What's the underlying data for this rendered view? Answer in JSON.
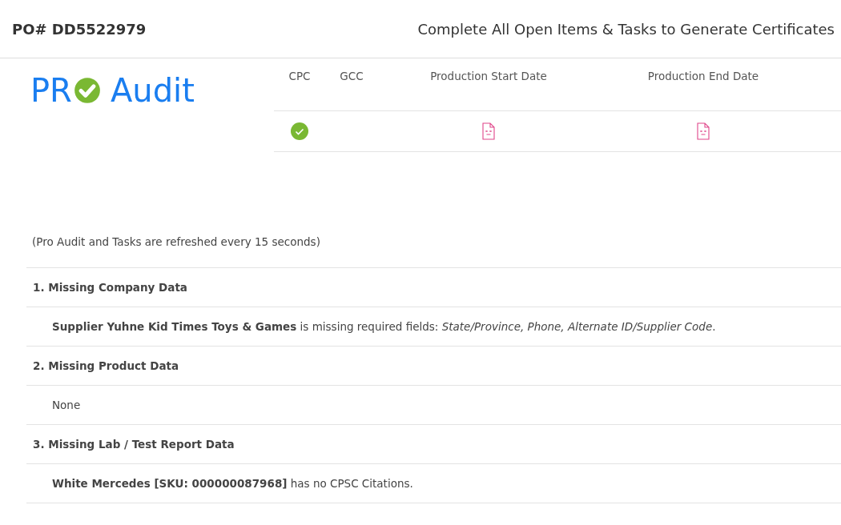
{
  "header": {
    "po_number": "PO# DD5522979",
    "message": "Complete All Open Items & Tasks to Generate Certificates"
  },
  "logo": {
    "prefix": "PR",
    "suffix": "Audit"
  },
  "status_table": {
    "columns": [
      {
        "label": "CPC",
        "kind": "complete"
      },
      {
        "label": "GCC"
      },
      {
        "label": "Production Start Date",
        "kind": "missing"
      },
      {
        "label": "Production End Date",
        "kind": "missing"
      }
    ]
  },
  "refresh_note": "(Pro Audit and Tasks are refreshed every 15 seconds)",
  "sections": [
    {
      "title": "1. Missing Company Data",
      "items": [
        "**Supplier Yuhne Kid Times Toys & Games** is missing required fields: *State/Province, Phone, Alternate ID/Supplier Code*."
      ]
    },
    {
      "title": "2. Missing Product Data",
      "items": [
        "None"
      ]
    },
    {
      "title": "3. Missing Lab / Test Report Data",
      "items": [
        "**White Mercedes [SKU: 000000087968]** has no CPSC Citations."
      ]
    }
  ]
}
